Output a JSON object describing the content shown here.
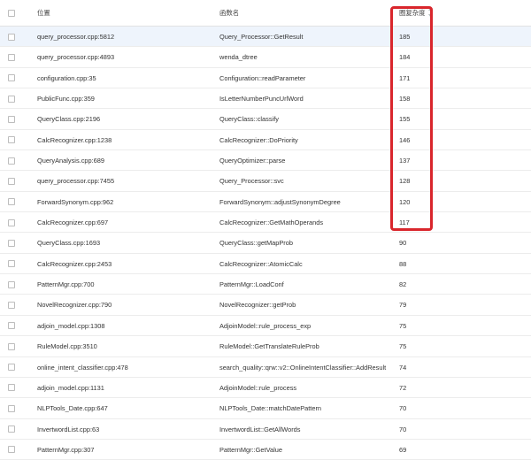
{
  "table": {
    "columns": {
      "location": "位置",
      "function": "函数名",
      "complexity": "圈复杂度"
    },
    "rows": [
      {
        "location": "query_processor.cpp:5812",
        "function": "Query_Processor::GetResult",
        "complexity": "185"
      },
      {
        "location": "query_processor.cpp:4893",
        "function": "wenda_dtree",
        "complexity": "184"
      },
      {
        "location": "configuration.cpp:35",
        "function": "Configuration::readParameter",
        "complexity": "171"
      },
      {
        "location": "PublicFunc.cpp:359",
        "function": "IsLetterNumberPuncUrlWord",
        "complexity": "158"
      },
      {
        "location": "QueryClass.cpp:2196",
        "function": "QueryClass::classify",
        "complexity": "155"
      },
      {
        "location": "CalcRecognizer.cpp:1238",
        "function": "CalcRecognizer::DoPriority",
        "complexity": "146"
      },
      {
        "location": "QueryAnalysis.cpp:689",
        "function": "QueryOptimizer::parse",
        "complexity": "137"
      },
      {
        "location": "query_processor.cpp:7455",
        "function": "Query_Processor::svc",
        "complexity": "128"
      },
      {
        "location": "ForwardSynonym.cpp:962",
        "function": "ForwardSynonym::adjustSynonymDegree",
        "complexity": "120"
      },
      {
        "location": "CalcRecognizer.cpp:697",
        "function": "CalcRecognizer::GetMathOperands",
        "complexity": "117"
      },
      {
        "location": "QueryClass.cpp:1693",
        "function": "QueryClass::getMapProb",
        "complexity": "90"
      },
      {
        "location": "CalcRecognizer.cpp:2453",
        "function": "CalcRecognizer::AtomicCalc",
        "complexity": "88"
      },
      {
        "location": "PatternMgr.cpp:700",
        "function": "PatternMgr::LoadConf",
        "complexity": "82"
      },
      {
        "location": "NovelRecognizer.cpp:790",
        "function": "NovelRecognizer::getProb",
        "complexity": "79"
      },
      {
        "location": "adjoin_model.cpp:1308",
        "function": "AdjoinModel::rule_process_exp",
        "complexity": "75"
      },
      {
        "location": "RuleModel.cpp:3510",
        "function": "RuleModel::GetTranslateRuleProb",
        "complexity": "75"
      },
      {
        "location": "online_intent_classifier.cpp:478",
        "function": "search_quality::qrw::v2::OnlineIntentClassifier::AddResult",
        "complexity": "74"
      },
      {
        "location": "adjoin_model.cpp:1131",
        "function": "AdjoinModel::rule_process",
        "complexity": "72"
      },
      {
        "location": "NLPTools_Date.cpp:647",
        "function": "NLPTools_Date::matchDatePattern",
        "complexity": "70"
      },
      {
        "location": "InvertwordList.cpp:63",
        "function": "InvertwordList::GetAllWords",
        "complexity": "70"
      },
      {
        "location": "PatternMgr.cpp:307",
        "function": "PatternMgr::GetValue",
        "complexity": "69"
      }
    ]
  },
  "highlight": {
    "color": "#d9262c",
    "hover_row_color": "#eef4fc"
  }
}
